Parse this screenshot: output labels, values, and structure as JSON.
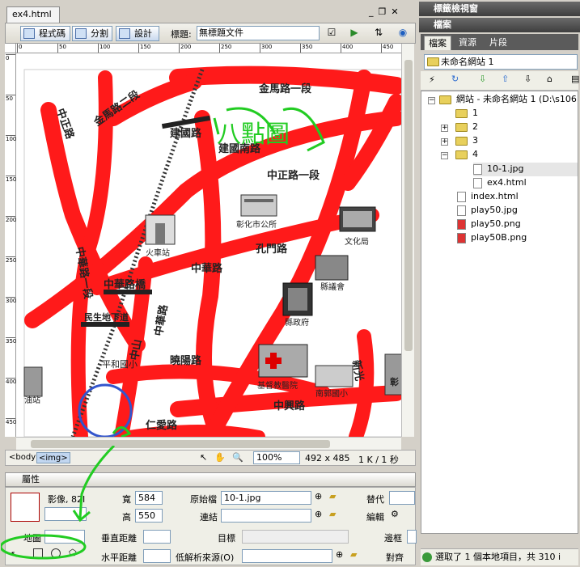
{
  "doc": {
    "filename": "ex4.html",
    "window_buttons": [
      "_",
      "❐",
      "✕"
    ]
  },
  "toolbar": {
    "code_label": "程式碼",
    "split_label": "分割",
    "design_label": "設計",
    "title_label": "標題:",
    "title_value": "無標題文件"
  },
  "ruler": {
    "h_ticks": [
      "0",
      "50",
      "100",
      "150",
      "200",
      "250",
      "300",
      "350",
      "400",
      "450"
    ],
    "v_ticks": [
      "0",
      "50",
      "100",
      "150",
      "200",
      "250",
      "300",
      "350",
      "400",
      "450"
    ]
  },
  "map": {
    "handwritten_title": "八點圖",
    "roads": [
      "金馬路一段",
      "金馬路二段",
      "中正路",
      "中正路一段",
      "建國南路",
      "建國路",
      "彰化市公所",
      "文化局",
      "火車站",
      "孔門路",
      "中華路",
      "中華路橋",
      "縣議會",
      "縣政府",
      "民生地下道",
      "平和國小",
      "中山",
      "中華路",
      "曉陽路",
      "基督教醫院",
      "南郭國小",
      "中興路",
      "仁愛路",
      "新光",
      "油站",
      "彰",
      "中華路一段"
    ]
  },
  "status": {
    "tags": [
      "<body>",
      "<img>"
    ],
    "zoom": "100%",
    "dimensions": "492 x 485",
    "size": "1 K / 1 秒"
  },
  "properties": {
    "header": "屬性",
    "image_label": "影像, 82I",
    "width_label": "寬",
    "width_value": "584",
    "height_label": "高",
    "height_value": "550",
    "src_label": "原始檔",
    "src_value": "10-1.jpg",
    "link_label": "連結",
    "link_value": "",
    "alt_label": "替代",
    "edit_label": "編輯",
    "map_label": "地圖",
    "vspace_label": "垂直距離",
    "hspace_label": "水平距離",
    "target_label": "目標",
    "lowsrc_label": "低解析來源(O)",
    "border_label": "邊框",
    "align_label": "對齊"
  },
  "right_panel": {
    "tag_inspector": "標籤檢視窗",
    "files_panel": "檔案",
    "tabs": [
      "檔案",
      "資源",
      "片段"
    ],
    "site_name": "未命名網站 1",
    "tree": [
      {
        "label": "網站 - 未命名網站 1 (D:\\s106",
        "type": "folder"
      },
      {
        "label": "1",
        "type": "folder"
      },
      {
        "label": "2",
        "type": "folder"
      },
      {
        "label": "3",
        "type": "folder"
      },
      {
        "label": "4",
        "type": "folder"
      },
      {
        "label": "10-1.jpg",
        "type": "file"
      },
      {
        "label": "ex4.html",
        "type": "file"
      },
      {
        "label": "index.html",
        "type": "file"
      },
      {
        "label": "play50.jpg",
        "type": "file"
      },
      {
        "label": "play50.png",
        "type": "file"
      },
      {
        "label": "play50B.png",
        "type": "file"
      }
    ],
    "status": "選取了 1 個本地項目，共 310 i"
  },
  "colors": {
    "road_red": "#ff1a1a",
    "annotation_green": "#22cc22"
  }
}
